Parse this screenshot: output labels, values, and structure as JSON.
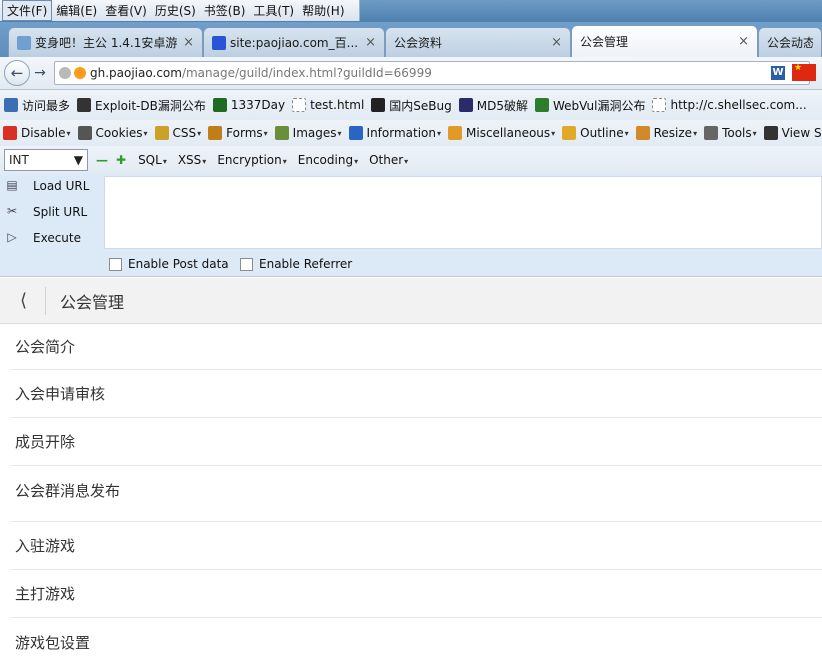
{
  "menubar": {
    "items": [
      "文件(F)",
      "编辑(E)",
      "查看(V)",
      "历史(S)",
      "书签(B)",
      "工具(T)",
      "帮助(H)"
    ]
  },
  "tabs": [
    {
      "label": "变身吧！主公 1.4.1安卓游...",
      "close": "×"
    },
    {
      "label": "site:paojiao.com_百...",
      "close": "×"
    },
    {
      "label": "公会资料",
      "close": "×"
    },
    {
      "label": "公会管理",
      "close": "×"
    },
    {
      "label": "公会动态",
      "close": ""
    }
  ],
  "navbar": {
    "url_host": "gh.paojiao.com",
    "url_path": "/manage/guild/index.html?guildId=66999"
  },
  "bookmarks": [
    {
      "label": "访问最多",
      "icon": "search-bookmark-icon",
      "color": "#3a6fb5"
    },
    {
      "label": "Exploit-DB漏洞公布",
      "icon": "exploit-db-icon",
      "color": "#333333"
    },
    {
      "label": "1337Day",
      "icon": "1337day-icon",
      "color": "#1f6b1f"
    },
    {
      "label": "test.html",
      "icon": "page-icon",
      "color": "#ffffff"
    },
    {
      "label": "国内SeBug",
      "icon": "sebug-icon",
      "color": "#222222"
    },
    {
      "label": "MD5破解",
      "icon": "md5-icon",
      "color": "#2b2b6b"
    },
    {
      "label": "WebVul漏洞公布",
      "icon": "webvul-icon",
      "color": "#2d7d2d"
    },
    {
      "label": "http://c.shellsec.com...",
      "icon": "page-icon",
      "color": "#ffffff"
    }
  ],
  "webdev_toolbar": [
    {
      "label": "Disable",
      "icon": "disable-icon",
      "color": "#d93025"
    },
    {
      "label": "Cookies",
      "icon": "cookies-icon",
      "color": "#555555"
    },
    {
      "label": "CSS",
      "icon": "css-icon",
      "color": "#c9a227"
    },
    {
      "label": "Forms",
      "icon": "forms-icon",
      "color": "#c27d1b"
    },
    {
      "label": "Images",
      "icon": "images-icon",
      "color": "#6b8e3a"
    },
    {
      "label": "Information",
      "icon": "information-icon",
      "color": "#2b65c4"
    },
    {
      "label": "Miscellaneous",
      "icon": "miscellaneous-icon",
      "color": "#e09a2a"
    },
    {
      "label": "Outline",
      "icon": "outline-icon",
      "color": "#e0a92a"
    },
    {
      "label": "Resize",
      "icon": "resize-icon",
      "color": "#d08a2a"
    },
    {
      "label": "Tools",
      "icon": "tools-icon",
      "color": "#666666"
    },
    {
      "label": "View S",
      "icon": "view-source-icon",
      "color": "#333333"
    }
  ],
  "hackbar": {
    "select_value": "INT",
    "menus": [
      "SQL",
      "XSS",
      "Encryption",
      "Encoding",
      "Other"
    ],
    "actions": [
      "Load URL",
      "Split URL",
      "Execute"
    ],
    "checkboxes": [
      "Enable Post data",
      "Enable Referrer"
    ]
  },
  "page": {
    "title": "公会管理",
    "menu_items": [
      "公会简介",
      "入会申请审核",
      "成员开除",
      "公会群消息发布",
      "入驻游戏",
      "主打游戏",
      "游戏包设置"
    ]
  }
}
